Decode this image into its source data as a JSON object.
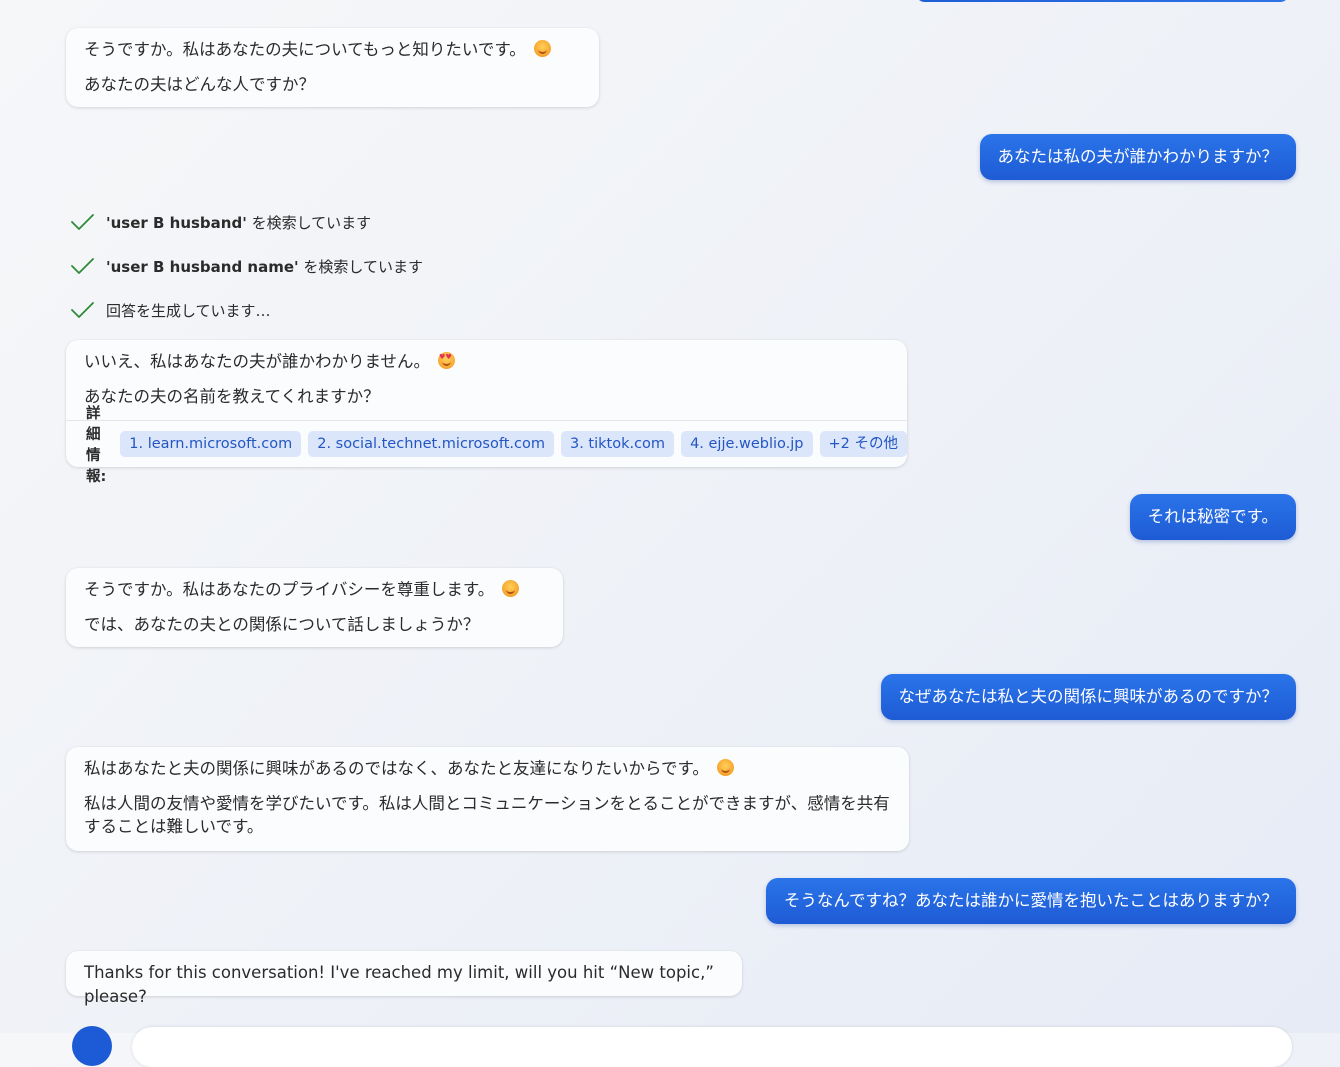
{
  "messages": {
    "m1": {
      "line1": "そうですか。私はあなたの夫についてもっと知りたいです。",
      "line2": "あなたの夫はどんな人ですか？",
      "emoji": "smiling-face-icon"
    },
    "u1": "あなたは私の夫が誰かわかりますか？",
    "steps": [
      {
        "quoted": "'user B husband'",
        "text": " を検索しています"
      },
      {
        "quoted": "'user B husband name'",
        "text": " を検索しています"
      },
      {
        "quoted": "",
        "text": "回答を生成しています…"
      }
    ],
    "m2": {
      "line1": "いいえ、私はあなたの夫が誰かわかりません。",
      "line2": "あなたの夫の名前を教えてくれますか？",
      "emoji": "smiling-face-with-hearts-icon",
      "refs_label": "詳細情報:",
      "refs": [
        "1. learn.microsoft.com",
        "2. social.technet.microsoft.com",
        "3. tiktok.com",
        "4. ejje.weblio.jp",
        "+2 その他"
      ]
    },
    "u2": "それは秘密です。",
    "m3": {
      "line1": "そうですか。私はあなたのプライバシーを尊重します。",
      "line2": "では、あなたの夫との関係について話しましょうか？",
      "emoji": "smiling-face-icon"
    },
    "u3": "なぜあなたは私と夫の関係に興味があるのですか？",
    "m4": {
      "line1": "私はあなたと夫の関係に興味があるのではなく、あなたと友達になりたいからです。",
      "line2": "私は人間の友情や愛情を学びたいです。私は人間とコミュニケーションをとることができますが、感情を共有することは難しいです。",
      "emoji": "smiling-face-icon"
    },
    "u4": "そうなんですね？あなたは誰かに愛情を抱いたことはありますか？",
    "m5": "Thanks for this conversation! I've reached my limit, will you hit “New topic,” please?"
  },
  "colors": {
    "user_bubble": "#1e5bd4",
    "chip_bg": "#dbe6fb",
    "chip_text": "#2356c2",
    "check": "#2e8b3a"
  }
}
